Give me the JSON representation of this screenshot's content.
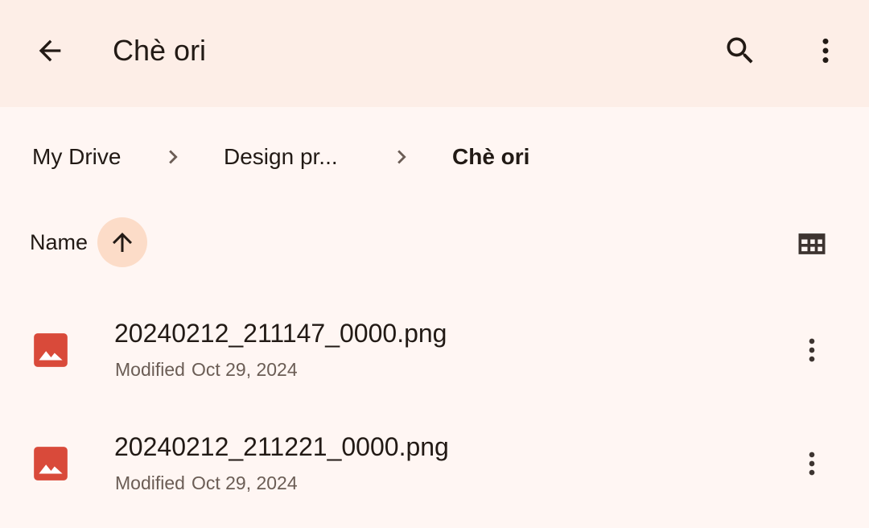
{
  "appbar": {
    "title": "Chè ori",
    "back_icon": "arrow-back-icon",
    "search_icon": "search-icon",
    "more_icon": "more-vert-icon"
  },
  "breadcrumb": {
    "items": [
      {
        "label": "My Drive",
        "current": false
      },
      {
        "label": "Design pr...",
        "current": false
      },
      {
        "label": "Chè ori",
        "current": true
      }
    ],
    "separator_icon": "chevron-right-icon"
  },
  "sort": {
    "label": "Name",
    "direction": "ascending",
    "direction_icon": "arrow-upward-icon",
    "view_toggle_icon": "grid-view-icon"
  },
  "files": [
    {
      "name": "20240212_211147_0000.png",
      "modified_label": "Modified",
      "modified_date": "Oct 29, 2024",
      "type_icon": "image-file-icon"
    },
    {
      "name": "20240212_211221_0000.png",
      "modified_label": "Modified",
      "modified_date": "Oct 29, 2024",
      "type_icon": "image-file-icon"
    }
  ],
  "colors": {
    "appbar_bg": "#fdeee7",
    "page_bg": "#fff6f3",
    "sort_chip": "#fcdcc8",
    "image_icon_red": "#d94a3a",
    "text_primary": "#221a15",
    "text_secondary": "#6b5d55"
  }
}
